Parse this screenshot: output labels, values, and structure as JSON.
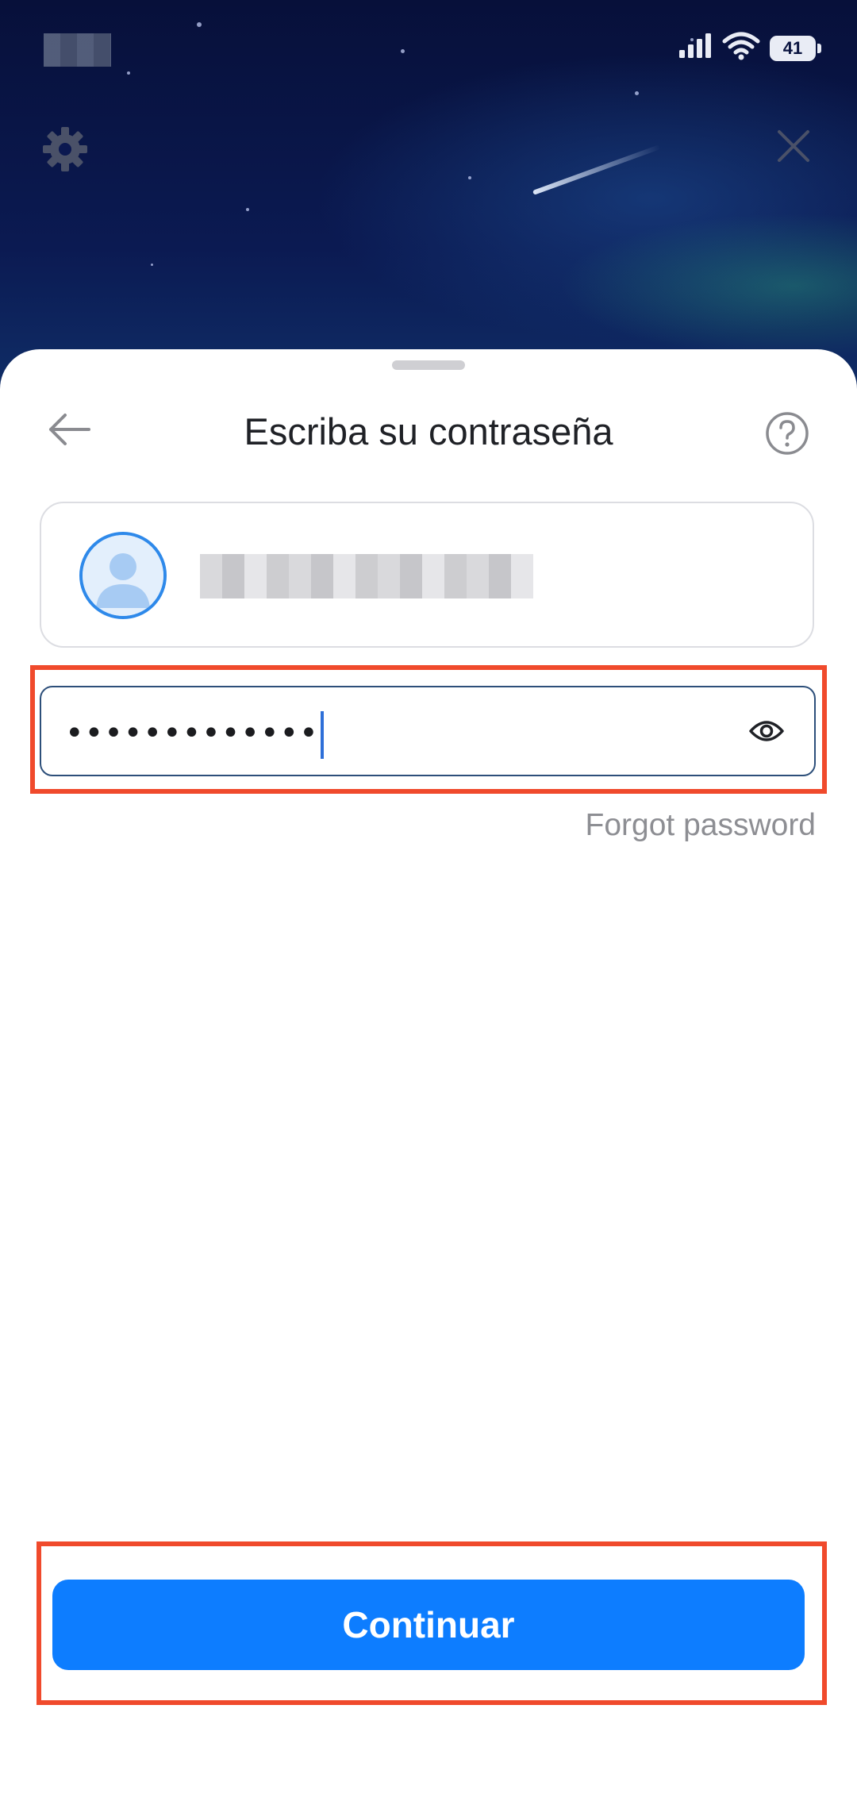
{
  "status_bar": {
    "battery_level": "41",
    "icons": [
      "signal-icon",
      "wifi-icon",
      "battery-icon"
    ]
  },
  "top_bar": {
    "icons": [
      "gear-icon",
      "close-icon"
    ]
  },
  "sheet": {
    "title": "Escriba su contraseña",
    "back_icon": "arrow-left-icon",
    "help_icon": "help-circle-icon",
    "account": {
      "avatar_icon": "user-avatar-icon",
      "name": ""
    },
    "password": {
      "value": "•••••••••••••",
      "toggle_icon": "eye-icon"
    },
    "forgot_password": "Forgot password",
    "continue_button": "Continuar"
  },
  "colors": {
    "primary": "#0d7dff",
    "highlight": "#f04a2c",
    "background_top": "#0a1440"
  }
}
